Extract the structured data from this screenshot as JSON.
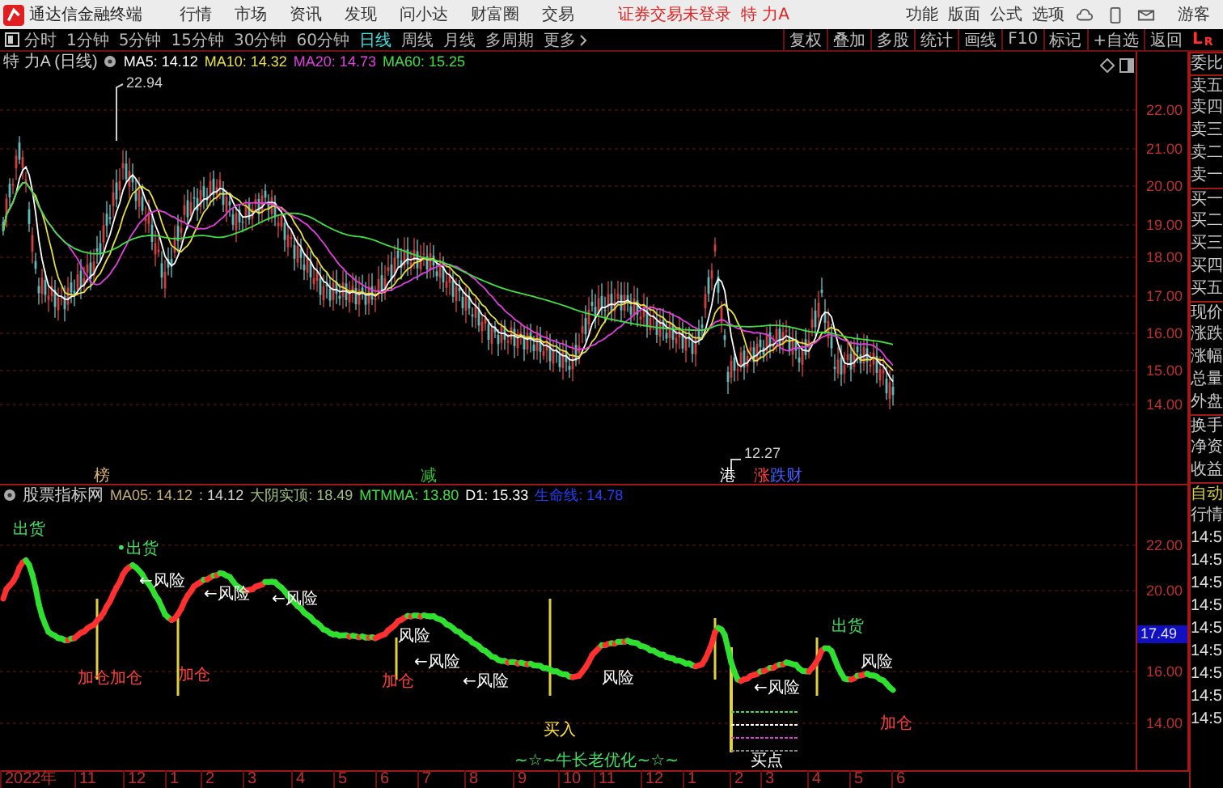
{
  "app_bar": {
    "title": "通达信金融终端",
    "menu": [
      "行情",
      "市场",
      "资讯",
      "发现",
      "问小达",
      "财富圈",
      "交易"
    ],
    "login_status": "证券交易未登录",
    "stock": "特 力A",
    "actions": [
      "功能",
      "版面",
      "公式",
      "选项"
    ],
    "user": "游客"
  },
  "period_bar": {
    "periods": [
      {
        "label": "分时",
        "selected": false
      },
      {
        "label": "1分钟",
        "selected": false
      },
      {
        "label": "5分钟",
        "selected": false
      },
      {
        "label": "15分钟",
        "selected": false
      },
      {
        "label": "30分钟",
        "selected": false
      },
      {
        "label": "60分钟",
        "selected": false
      },
      {
        "label": "日线",
        "selected": true
      },
      {
        "label": "周线",
        "selected": false
      },
      {
        "label": "月线",
        "selected": false
      },
      {
        "label": "多周期",
        "selected": false
      },
      {
        "label": "更多",
        "selected": false
      }
    ],
    "tools": [
      "复权",
      "叠加",
      "多股",
      "统计",
      "画线",
      "F10",
      "标记",
      "+自选",
      "返回"
    ],
    "panel_tabs": [
      "L",
      "R"
    ]
  },
  "main_chart": {
    "title": "特 力A (日线)",
    "ma": [
      {
        "label": "MA5: 14.12",
        "color": "#ffffff"
      },
      {
        "label": "MA10: 14.32",
        "color": "#e8e040"
      },
      {
        "label": "MA20: 14.73",
        "color": "#e040e0"
      },
      {
        "label": "MA60: 15.25",
        "color": "#40e040"
      }
    ],
    "high_label": "22.94",
    "low_label": "12.27",
    "axis": [
      "22.00",
      "21.00",
      "20.00",
      "19.00",
      "18.00",
      "17.00",
      "16.00",
      "15.00",
      "14.00"
    ],
    "markers": [
      {
        "text": "榜",
        "color": "#d8b070"
      },
      {
        "text": "减",
        "color": "#30c030"
      },
      {
        "text": "港",
        "color": "#ffffff"
      },
      {
        "text": "涨",
        "color": "#ff4040"
      },
      {
        "text": "跌财",
        "color": "#4060ff"
      }
    ]
  },
  "indicator": {
    "name": "股票指标网",
    "values": [
      {
        "text": "MA05: 14.12",
        "color": "#c8b070"
      },
      {
        "text": ": 14.12",
        "color": "#d0d0d0"
      },
      {
        "text": "大阴实顶: 18.49",
        "color": "#a0c080"
      },
      {
        "text": "MTMMA: 13.80",
        "color": "#40e040"
      },
      {
        "text": "D1: 15.33",
        "color": "#ffffff"
      },
      {
        "text": "生命线: 14.78",
        "color": "#2040ff"
      }
    ],
    "signals": [
      {
        "text": "出货",
        "kind": "sell"
      },
      {
        "text": "•出货",
        "kind": "sell"
      },
      {
        "text": "←风险",
        "kind": "risk"
      },
      {
        "text": "←风险",
        "kind": "risk"
      },
      {
        "text": "←风险",
        "kind": "risk"
      },
      {
        "text": "加仓加仓",
        "kind": "add"
      },
      {
        "text": "加仓",
        "kind": "add"
      },
      {
        "text": "风险",
        "kind": "risk"
      },
      {
        "text": "加仓",
        "kind": "add"
      },
      {
        "text": "←风险",
        "kind": "risk"
      },
      {
        "text": "←风险",
        "kind": "risk"
      },
      {
        "text": "买入",
        "kind": "buy"
      },
      {
        "text": "风险",
        "kind": "risk"
      },
      {
        "text": "←风险",
        "kind": "risk"
      },
      {
        "text": "出货",
        "kind": "sell"
      },
      {
        "text": "风险",
        "kind": "risk"
      },
      {
        "text": "加仓",
        "kind": "add"
      },
      {
        "text": "买点",
        "kind": "point"
      },
      {
        "text": "~☆~牛长老优化~☆~",
        "kind": "credit"
      }
    ],
    "axis": [
      "22.00",
      "20.00",
      "16.00",
      "14.00"
    ],
    "current": "17.49"
  },
  "time_axis": [
    "2022年",
    "11",
    "12",
    "1",
    "2",
    "3",
    "4",
    "5",
    "6",
    "7",
    "8",
    "9",
    "10",
    "11",
    "12",
    "1",
    "2",
    "3",
    "4",
    "5",
    "6"
  ],
  "quote_panel": {
    "rows": [
      "委比",
      "卖五",
      "卖四",
      "卖三",
      "卖二",
      "卖一",
      "买一",
      "买二",
      "买三",
      "买四",
      "买五",
      "现价",
      "涨跌",
      "涨幅",
      "总量",
      "外盘",
      "换手",
      "净资",
      "收益"
    ],
    "feed_title": "自动",
    "feed_subtitle": "行情",
    "times": [
      "14:5",
      "14:5",
      "14:5",
      "14:5",
      "14:5",
      "14:5",
      "14:5",
      "14:5",
      "14:5"
    ]
  }
}
